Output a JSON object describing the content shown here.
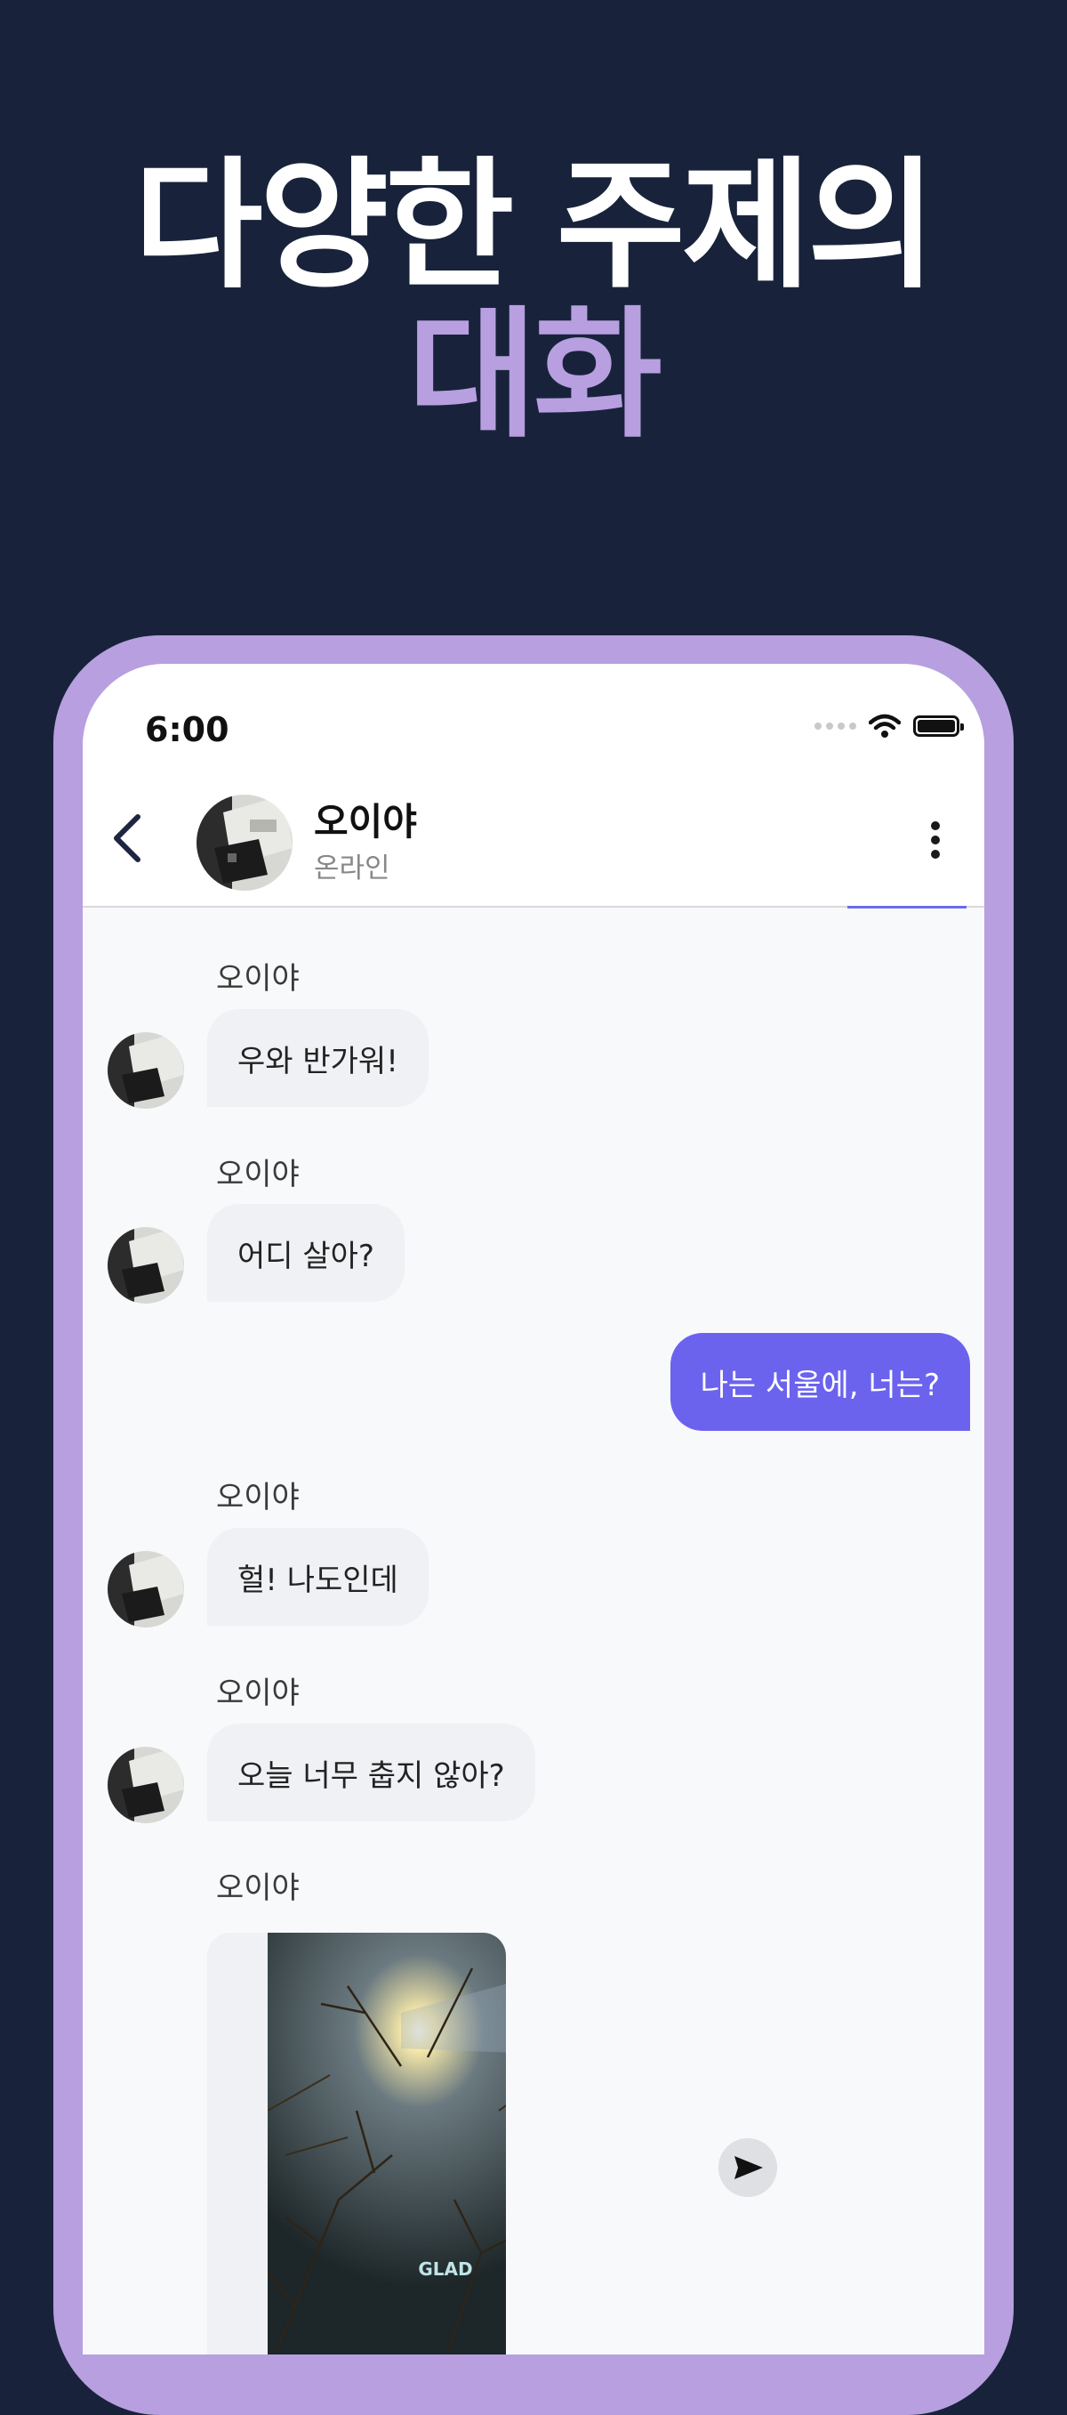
{
  "promo": {
    "headline_line1": "다양한 주제의",
    "headline_line2": "대화",
    "accent_color": "#b79fe0",
    "background_color": "#18233b"
  },
  "status_bar": {
    "time": "6:00"
  },
  "chat_header": {
    "contact_name": "오이야",
    "contact_status": "온라인",
    "back_icon": "chevron-left-icon",
    "more_icon": "more-vertical-icon"
  },
  "messages": [
    {
      "sender": "오이야",
      "direction": "incoming",
      "text": "우와 반가워!"
    },
    {
      "sender": "오이야",
      "direction": "incoming",
      "text": "어디 살아?"
    },
    {
      "sender": "me",
      "direction": "outgoing",
      "text": "나는 서울에, 너는?"
    },
    {
      "sender": "오이야",
      "direction": "incoming",
      "text": "헐! 나도인데"
    },
    {
      "sender": "오이야",
      "direction": "incoming",
      "text": "오늘 너무 춥지 않아?"
    },
    {
      "sender": "오이야",
      "direction": "incoming",
      "type": "image",
      "image_text": "GLAD"
    }
  ],
  "colors": {
    "outgoing_bubble": "#6b63ee",
    "incoming_bubble": "#f0f1f4"
  },
  "icons": {
    "share": "send-arrow-icon"
  }
}
